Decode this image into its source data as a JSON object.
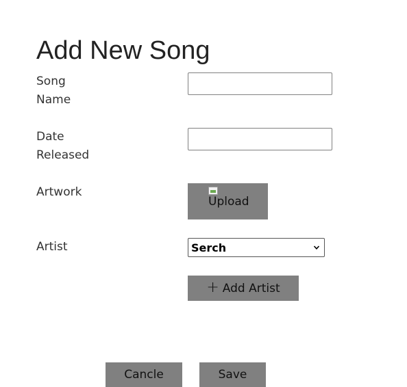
{
  "form": {
    "title": "Add New Song",
    "song_name": {
      "label": "Song Name",
      "value": "",
      "placeholder": ""
    },
    "date_released": {
      "label": "Date Released",
      "value": "",
      "placeholder": ""
    },
    "artwork": {
      "label": "Artwork",
      "upload_label": "Upload",
      "upload_icon": "broken-image-icon"
    },
    "artist": {
      "label": "Artist",
      "selected": "Serch",
      "dropdown_icon": "chevron-down-icon"
    },
    "add_artist": {
      "icon": "+",
      "label": "Add Artist"
    }
  },
  "actions": {
    "cancel_label": "Cancle",
    "save_label": "Save"
  },
  "colors": {
    "button_bg": "#808080",
    "text": "#222222",
    "input_border": "#808080"
  }
}
